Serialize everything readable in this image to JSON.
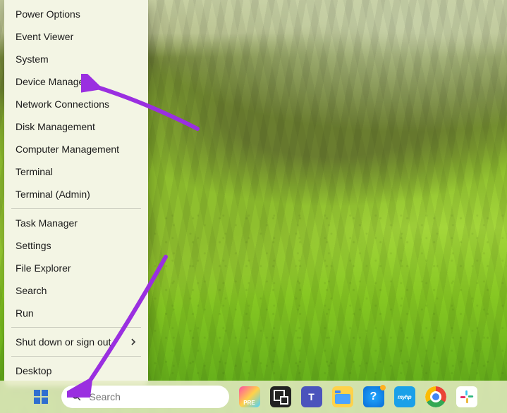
{
  "colors": {
    "accent": "#2f6fd0",
    "annotation": "#9a2fe0",
    "menu_bg": "#f3f5e4",
    "taskbar_bg": "rgba(230,236,198,0.85)"
  },
  "winx_menu": {
    "groups": [
      [
        "Power Options",
        "Event Viewer",
        "System",
        "Device Manager",
        "Network Connections",
        "Disk Management",
        "Computer Management",
        "Terminal",
        "Terminal (Admin)"
      ],
      [
        "Task Manager",
        "Settings",
        "File Explorer",
        "Search",
        "Run"
      ],
      [
        "Shut down or sign out"
      ],
      [
        "Desktop"
      ]
    ],
    "submenu_items": [
      "Shut down or sign out"
    ]
  },
  "taskbar": {
    "search_placeholder": "Search",
    "icons": [
      {
        "id": "preview",
        "name": "insider-preview-icon",
        "tooltip": "Preview"
      },
      {
        "id": "taskview",
        "name": "task-view-icon",
        "tooltip": "Task View"
      },
      {
        "id": "teams",
        "name": "teams-icon",
        "tooltip": "Microsoft Teams"
      },
      {
        "id": "explorer",
        "name": "file-explorer-icon",
        "tooltip": "File Explorer"
      },
      {
        "id": "tips",
        "name": "tips-icon",
        "tooltip": "Tips"
      },
      {
        "id": "myhp",
        "name": "myhp-icon",
        "tooltip": "myHP"
      },
      {
        "id": "chrome",
        "name": "chrome-icon",
        "tooltip": "Google Chrome"
      },
      {
        "id": "slack",
        "name": "slack-icon",
        "tooltip": "Slack"
      }
    ]
  },
  "annotations": {
    "highlight_menu_item": "Device Manager",
    "highlight_taskbar_target": "start-button"
  }
}
